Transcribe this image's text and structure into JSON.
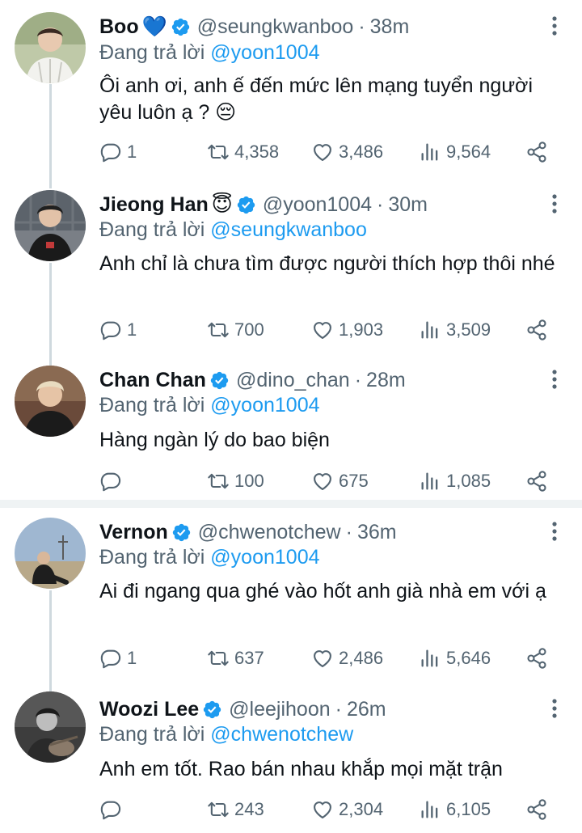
{
  "reply_prefix": "Đang trả lời",
  "tweets": [
    {
      "name": "Boo",
      "emoji": "💙",
      "handle": "@seungkwanboo",
      "time": "38m",
      "reply_to": "@yoon1004",
      "text": "Ôi anh ơi, anh ế đến mức lên mạng tuyển người yêu luôn ạ ? 😔",
      "replies": "1",
      "retweets": "4,358",
      "likes": "3,486",
      "views": "9,564"
    },
    {
      "name": "Jieong Han",
      "emoji": "😇",
      "handle": "@yoon1004",
      "time": "30m",
      "reply_to": "@seungkwanboo",
      "text": "Anh chỉ là chưa tìm được người thích hợp thôi nhé",
      "replies": "1",
      "retweets": "700",
      "likes": "1,903",
      "views": "3,509"
    },
    {
      "name": "Chan Chan",
      "emoji": "",
      "handle": "@dino_chan",
      "time": "28m",
      "reply_to": "@yoon1004",
      "text": "Hàng ngàn lý do bao biện",
      "replies": "",
      "retweets": "100",
      "likes": "675",
      "views": "1,085"
    },
    {
      "name": "Vernon",
      "emoji": "",
      "handle": "@chwenotchew",
      "time": "36m",
      "reply_to": "@yoon1004",
      "text": "Ai đi ngang qua ghé vào hốt anh già nhà em với ạ",
      "replies": "1",
      "retweets": "637",
      "likes": "2,486",
      "views": "5,646"
    },
    {
      "name": "Woozi Lee",
      "emoji": "",
      "handle": "@leejihoon",
      "time": "26m",
      "reply_to": "@chwenotchew",
      "text": "Anh em tốt. Rao bán nhau khắp mọi mặt trận",
      "replies": "",
      "retweets": "243",
      "likes": "2,304",
      "views": "6,105"
    }
  ],
  "colors": {
    "accent": "#1d9bf0",
    "secondary_text": "#536471",
    "thread_line": "#cfd9de",
    "separator": "#eff3f4"
  },
  "icons": [
    "verified-badge-icon",
    "more-options-icon",
    "reply-icon",
    "retweet-icon",
    "like-icon",
    "views-icon",
    "share-icon"
  ]
}
